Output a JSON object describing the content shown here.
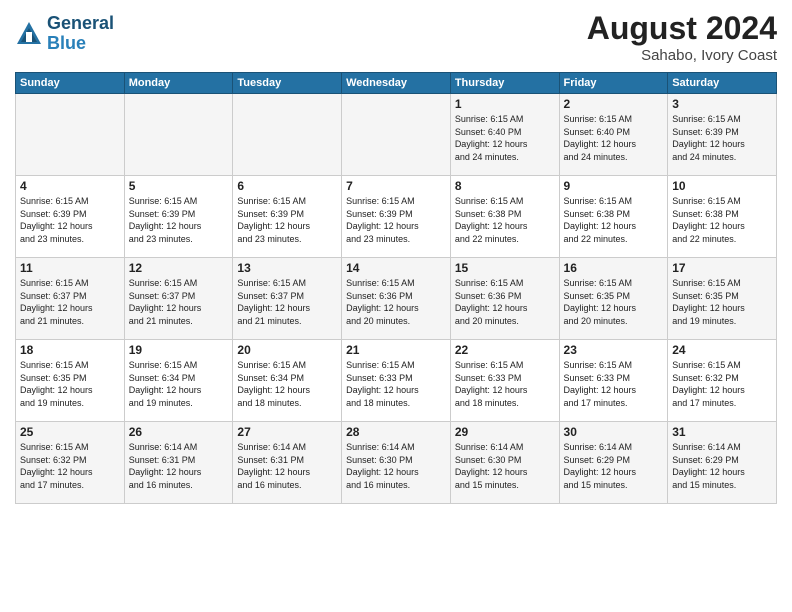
{
  "header": {
    "logo_general": "General",
    "logo_blue": "Blue",
    "month_year": "August 2024",
    "location": "Sahabo, Ivory Coast"
  },
  "days_of_week": [
    "Sunday",
    "Monday",
    "Tuesday",
    "Wednesday",
    "Thursday",
    "Friday",
    "Saturday"
  ],
  "weeks": [
    [
      {
        "day": "",
        "info": ""
      },
      {
        "day": "",
        "info": ""
      },
      {
        "day": "",
        "info": ""
      },
      {
        "day": "",
        "info": ""
      },
      {
        "day": "1",
        "info": "Sunrise: 6:15 AM\nSunset: 6:40 PM\nDaylight: 12 hours\nand 24 minutes."
      },
      {
        "day": "2",
        "info": "Sunrise: 6:15 AM\nSunset: 6:40 PM\nDaylight: 12 hours\nand 24 minutes."
      },
      {
        "day": "3",
        "info": "Sunrise: 6:15 AM\nSunset: 6:39 PM\nDaylight: 12 hours\nand 24 minutes."
      }
    ],
    [
      {
        "day": "4",
        "info": "Sunrise: 6:15 AM\nSunset: 6:39 PM\nDaylight: 12 hours\nand 23 minutes."
      },
      {
        "day": "5",
        "info": "Sunrise: 6:15 AM\nSunset: 6:39 PM\nDaylight: 12 hours\nand 23 minutes."
      },
      {
        "day": "6",
        "info": "Sunrise: 6:15 AM\nSunset: 6:39 PM\nDaylight: 12 hours\nand 23 minutes."
      },
      {
        "day": "7",
        "info": "Sunrise: 6:15 AM\nSunset: 6:39 PM\nDaylight: 12 hours\nand 23 minutes."
      },
      {
        "day": "8",
        "info": "Sunrise: 6:15 AM\nSunset: 6:38 PM\nDaylight: 12 hours\nand 22 minutes."
      },
      {
        "day": "9",
        "info": "Sunrise: 6:15 AM\nSunset: 6:38 PM\nDaylight: 12 hours\nand 22 minutes."
      },
      {
        "day": "10",
        "info": "Sunrise: 6:15 AM\nSunset: 6:38 PM\nDaylight: 12 hours\nand 22 minutes."
      }
    ],
    [
      {
        "day": "11",
        "info": "Sunrise: 6:15 AM\nSunset: 6:37 PM\nDaylight: 12 hours\nand 21 minutes."
      },
      {
        "day": "12",
        "info": "Sunrise: 6:15 AM\nSunset: 6:37 PM\nDaylight: 12 hours\nand 21 minutes."
      },
      {
        "day": "13",
        "info": "Sunrise: 6:15 AM\nSunset: 6:37 PM\nDaylight: 12 hours\nand 21 minutes."
      },
      {
        "day": "14",
        "info": "Sunrise: 6:15 AM\nSunset: 6:36 PM\nDaylight: 12 hours\nand 20 minutes."
      },
      {
        "day": "15",
        "info": "Sunrise: 6:15 AM\nSunset: 6:36 PM\nDaylight: 12 hours\nand 20 minutes."
      },
      {
        "day": "16",
        "info": "Sunrise: 6:15 AM\nSunset: 6:35 PM\nDaylight: 12 hours\nand 20 minutes."
      },
      {
        "day": "17",
        "info": "Sunrise: 6:15 AM\nSunset: 6:35 PM\nDaylight: 12 hours\nand 19 minutes."
      }
    ],
    [
      {
        "day": "18",
        "info": "Sunrise: 6:15 AM\nSunset: 6:35 PM\nDaylight: 12 hours\nand 19 minutes."
      },
      {
        "day": "19",
        "info": "Sunrise: 6:15 AM\nSunset: 6:34 PM\nDaylight: 12 hours\nand 19 minutes."
      },
      {
        "day": "20",
        "info": "Sunrise: 6:15 AM\nSunset: 6:34 PM\nDaylight: 12 hours\nand 18 minutes."
      },
      {
        "day": "21",
        "info": "Sunrise: 6:15 AM\nSunset: 6:33 PM\nDaylight: 12 hours\nand 18 minutes."
      },
      {
        "day": "22",
        "info": "Sunrise: 6:15 AM\nSunset: 6:33 PM\nDaylight: 12 hours\nand 18 minutes."
      },
      {
        "day": "23",
        "info": "Sunrise: 6:15 AM\nSunset: 6:33 PM\nDaylight: 12 hours\nand 17 minutes."
      },
      {
        "day": "24",
        "info": "Sunrise: 6:15 AM\nSunset: 6:32 PM\nDaylight: 12 hours\nand 17 minutes."
      }
    ],
    [
      {
        "day": "25",
        "info": "Sunrise: 6:15 AM\nSunset: 6:32 PM\nDaylight: 12 hours\nand 17 minutes."
      },
      {
        "day": "26",
        "info": "Sunrise: 6:14 AM\nSunset: 6:31 PM\nDaylight: 12 hours\nand 16 minutes."
      },
      {
        "day": "27",
        "info": "Sunrise: 6:14 AM\nSunset: 6:31 PM\nDaylight: 12 hours\nand 16 minutes."
      },
      {
        "day": "28",
        "info": "Sunrise: 6:14 AM\nSunset: 6:30 PM\nDaylight: 12 hours\nand 16 minutes."
      },
      {
        "day": "29",
        "info": "Sunrise: 6:14 AM\nSunset: 6:30 PM\nDaylight: 12 hours\nand 15 minutes."
      },
      {
        "day": "30",
        "info": "Sunrise: 6:14 AM\nSunset: 6:29 PM\nDaylight: 12 hours\nand 15 minutes."
      },
      {
        "day": "31",
        "info": "Sunrise: 6:14 AM\nSunset: 6:29 PM\nDaylight: 12 hours\nand 15 minutes."
      }
    ]
  ]
}
